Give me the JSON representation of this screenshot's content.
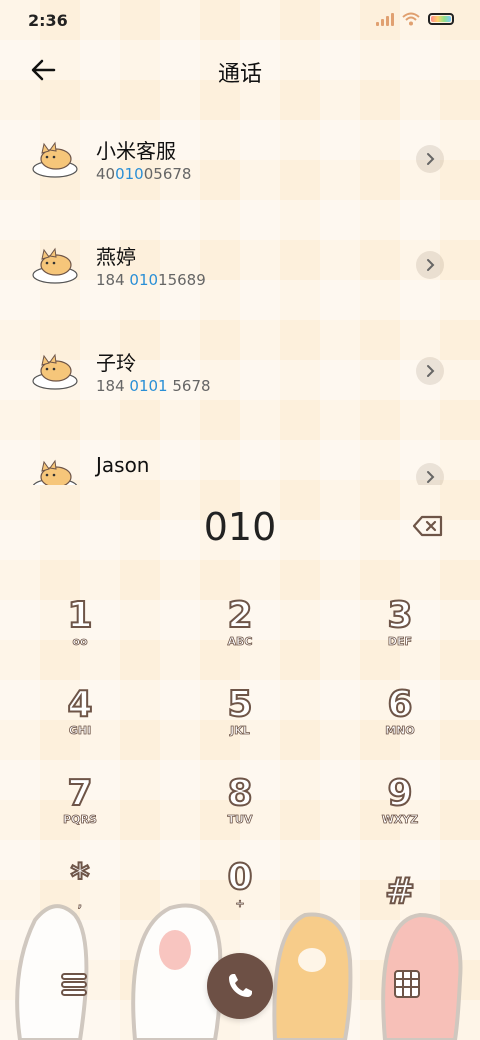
{
  "status": {
    "time": "2:36"
  },
  "header": {
    "title": "通话",
    "back_icon": "arrow-left-icon"
  },
  "contacts": [
    {
      "name": "小米客服",
      "number_parts": [
        "40",
        "010",
        "05678"
      ]
    },
    {
      "name": "燕婷",
      "number_parts": [
        "184 ",
        "010",
        "15689"
      ]
    },
    {
      "name": "子玲",
      "number_parts": [
        "184 ",
        "0101",
        " 5678"
      ]
    },
    {
      "name": "Jason",
      "number_parts": [
        "",
        "",
        ""
      ]
    }
  ],
  "dialer": {
    "input_value": "010",
    "keys": [
      {
        "digit": "1",
        "letters": "ᴏᴏ"
      },
      {
        "digit": "2",
        "letters": "ABC"
      },
      {
        "digit": "3",
        "letters": "DEF"
      },
      {
        "digit": "4",
        "letters": "GHI"
      },
      {
        "digit": "5",
        "letters": "JKL"
      },
      {
        "digit": "6",
        "letters": "MNO"
      },
      {
        "digit": "7",
        "letters": "PQRS"
      },
      {
        "digit": "8",
        "letters": "TUV"
      },
      {
        "digit": "9",
        "letters": "WXYZ"
      },
      {
        "digit": "*",
        "letters": ","
      },
      {
        "digit": "0",
        "letters": "+"
      },
      {
        "digit": "#",
        "letters": ""
      }
    ]
  },
  "colors": {
    "accent": "#6d5045",
    "highlight": "#2a8fd6",
    "background": "#fdf0dc"
  }
}
